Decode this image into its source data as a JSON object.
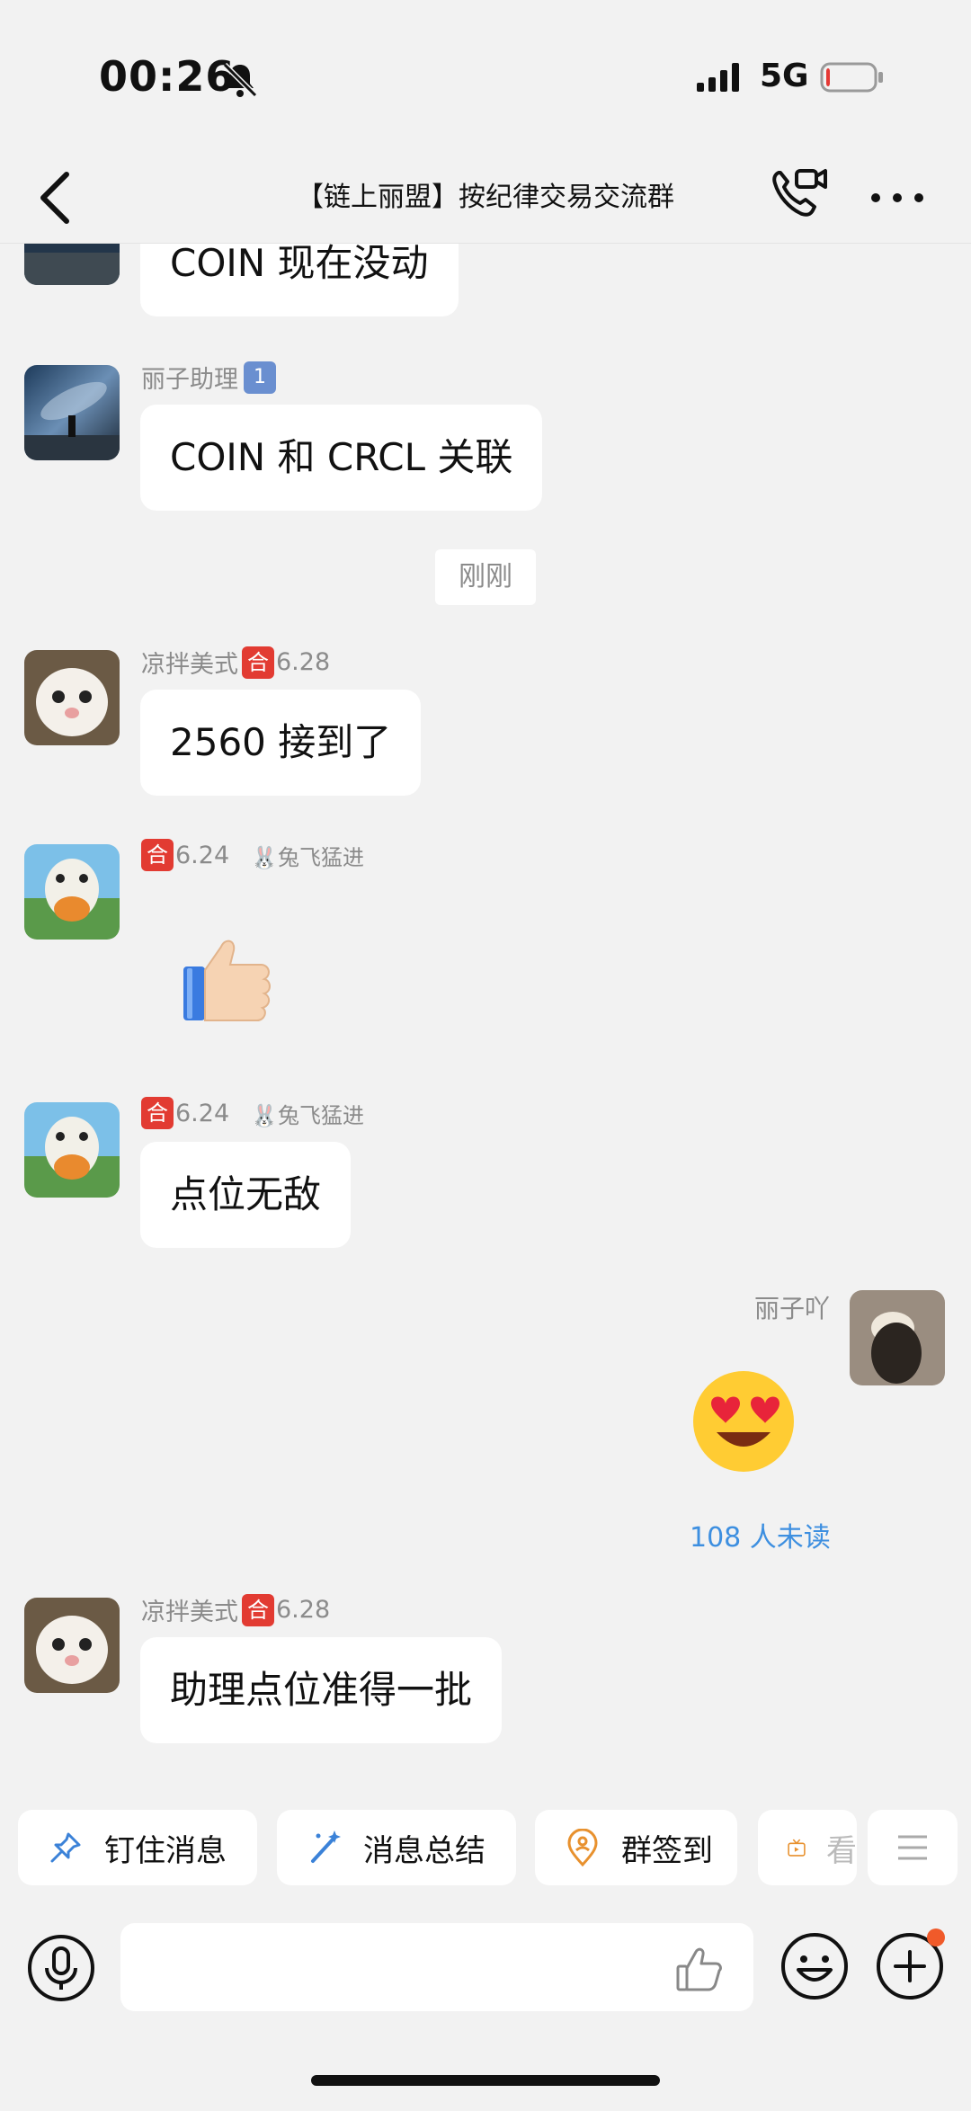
{
  "status_bar": {
    "time": "00:26",
    "network": "5G",
    "battery_level": 0.08
  },
  "header": {
    "title": "【链上丽盟】按纪律交易交流群"
  },
  "messages": [
    {
      "text": "COIN 现在没动"
    },
    {
      "sender": "丽子助理",
      "badge": "1",
      "text": "COIN 和 CRCL 关联"
    },
    {
      "time": "刚刚"
    },
    {
      "sender": "凉拌美式",
      "tag": "合",
      "level": "6.28",
      "text": "2560 接到了"
    },
    {
      "tag": "合",
      "level": "6.24",
      "title": "🐰兔飞猛进",
      "emoji": "thumbs-up"
    },
    {
      "tag": "合",
      "level": "6.24",
      "title": "🐰兔飞猛进",
      "text": "点位无敌"
    },
    {
      "sender": "丽子吖",
      "emoji": "heart-eyes",
      "unread": "108 人未读"
    },
    {
      "sender": "凉拌美式",
      "tag": "合",
      "level": "6.28",
      "text": "助理点位准得一批"
    }
  ],
  "quick_actions": [
    {
      "label": "钉住消息",
      "icon": "pin-icon"
    },
    {
      "label": "消息总结",
      "icon": "magic-wand-icon"
    },
    {
      "label": "群签到",
      "icon": "location-person-icon"
    },
    {
      "label": "看",
      "icon": "tv-icon"
    }
  ],
  "colors": {
    "accent_blue": "#3d8fe0",
    "tag_red": "#e23b32",
    "unread_dot": "#f05a2a"
  }
}
